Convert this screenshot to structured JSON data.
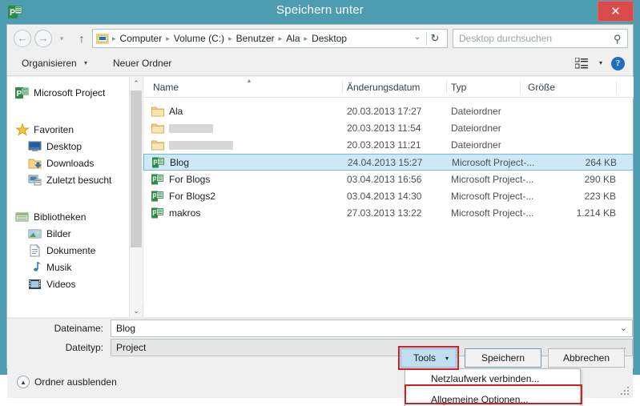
{
  "window": {
    "title": "Speichern unter",
    "app_icon": "project-icon",
    "close_label": "✕",
    "accent_color": "#4e9cb0",
    "close_color": "#d94a4a"
  },
  "navigation": {
    "back_icon": "←",
    "forward_icon": "→",
    "recent_icon": "▾",
    "up_icon": "↑",
    "breadcrumb": [
      "Computer",
      "Volume (C:)",
      "Benutzer",
      "Ala",
      "Desktop"
    ],
    "breadcrumb_separator": "▸",
    "breadcrumb_dropdown": "⌄",
    "refresh_icon": "↻",
    "search_placeholder": "Desktop durchsuchen",
    "search_value": "",
    "search_icon": "⚲"
  },
  "toolbar": {
    "organize_label": "Organisieren",
    "organize_caret": "▾",
    "new_folder_label": "Neuer Ordner",
    "view_caret": "▾",
    "help_label": "?"
  },
  "sidebar": {
    "items": [
      {
        "label": "Microsoft Project",
        "icon": "project-icon",
        "level": 0,
        "gap": 0
      },
      {
        "label": "Favoriten",
        "icon": "star-icon",
        "level": 0,
        "gap": 1
      },
      {
        "label": "Desktop",
        "icon": "desktop-icon",
        "level": 1,
        "gap": 0
      },
      {
        "label": "Downloads",
        "icon": "downloads-icon",
        "level": 1,
        "gap": 0
      },
      {
        "label": "Zuletzt besucht",
        "icon": "recent-places-icon",
        "level": 1,
        "gap": 0
      },
      {
        "label": "Bibliotheken",
        "icon": "libraries-icon",
        "level": 0,
        "gap": 1
      },
      {
        "label": "Bilder",
        "icon": "pictures-icon",
        "level": 1,
        "gap": 0
      },
      {
        "label": "Dokumente",
        "icon": "documents-icon",
        "level": 1,
        "gap": 0
      },
      {
        "label": "Musik",
        "icon": "music-icon",
        "level": 1,
        "gap": 0
      },
      {
        "label": "Videos",
        "icon": "videos-icon",
        "level": 1,
        "gap": 0
      }
    ],
    "scroll_up_icon": "⌃",
    "scroll_down_icon": "⌄"
  },
  "filelist": {
    "columns": [
      "Name",
      "Änderungsdatum",
      "Typ",
      "Größe"
    ],
    "sort_caret": "▴",
    "rows": [
      {
        "name": "Ala",
        "redacted": false,
        "date": "20.03.2013 17:27",
        "type": "Dateiordner",
        "size": "",
        "icon": "folder-icon",
        "selected": false
      },
      {
        "name": "",
        "redacted": true,
        "redact_width": 55,
        "date": "20.03.2013 11:54",
        "type": "Dateiordner",
        "size": "",
        "icon": "folder-icon",
        "selected": false
      },
      {
        "name": "",
        "redacted": true,
        "redact_width": 80,
        "date": "20.03.2013 11:21",
        "type": "Dateiordner",
        "size": "",
        "icon": "folder-icon",
        "selected": false
      },
      {
        "name": "Blog",
        "redacted": false,
        "date": "24.04.2013 15:27",
        "type": "Microsoft Project-...",
        "size": "264 KB",
        "icon": "project-file-icon",
        "selected": true
      },
      {
        "name": "For Blogs",
        "redacted": false,
        "date": "03.04.2013 16:56",
        "type": "Microsoft Project-...",
        "size": "290 KB",
        "icon": "project-file-icon",
        "selected": false
      },
      {
        "name": "For Blogs2",
        "redacted": false,
        "date": "03.04.2013 14:30",
        "type": "Microsoft Project-...",
        "size": "223 KB",
        "icon": "project-file-icon",
        "selected": false
      },
      {
        "name": "makros",
        "redacted": false,
        "date": "27.03.2013 13:22",
        "type": "Microsoft Project-...",
        "size": "1.214 KB",
        "icon": "project-file-icon",
        "selected": false
      }
    ]
  },
  "form": {
    "filename_label": "Dateiname:",
    "filename_value": "Blog",
    "filetype_label": "Dateityp:",
    "filetype_value": "Project",
    "dropdown_caret": "⌄"
  },
  "footer": {
    "hide_folders_label": "Ordner ausblenden",
    "hide_folders_icon": "▲",
    "tools_label": "Tools",
    "tools_caret": "▾",
    "save_label": "Speichern",
    "cancel_label": "Abbrechen"
  },
  "tools_menu": {
    "items": [
      {
        "label": "Netzlaufwerk verbinden...",
        "highlighted": false
      },
      {
        "label": "Allgemeine Optionen...",
        "highlighted": true
      }
    ]
  },
  "annotations": {
    "color": "#d11f26",
    "targets": [
      "tools-button",
      "allgemeine-optionen-menu-item"
    ]
  }
}
